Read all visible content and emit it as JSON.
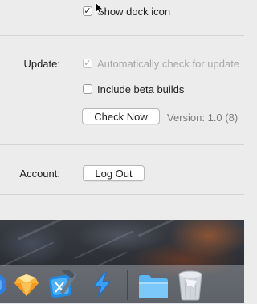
{
  "general": {
    "show_dock_icon_label": "Show dock icon",
    "show_dock_icon_checked": true
  },
  "update": {
    "section_label": "Update:",
    "auto_check_label": "Automatically check for update",
    "auto_check_checked": true,
    "auto_check_disabled": true,
    "beta_label": "Include beta builds",
    "beta_checked": false,
    "check_now_label": "Check Now",
    "version_text": "Version: 1.0 (8)"
  },
  "account": {
    "section_label": "Account:",
    "logout_label": "Log Out"
  },
  "dock": {
    "apps": [
      "partial-app-icon",
      "sketch-icon",
      "xcode-icon",
      "lightning-icon",
      "folder-icon",
      "trash-icon"
    ]
  },
  "colors": {
    "checkmark": "#222222",
    "disabled_text": "#a8a8a8",
    "version_text": "#7d7d7d"
  }
}
